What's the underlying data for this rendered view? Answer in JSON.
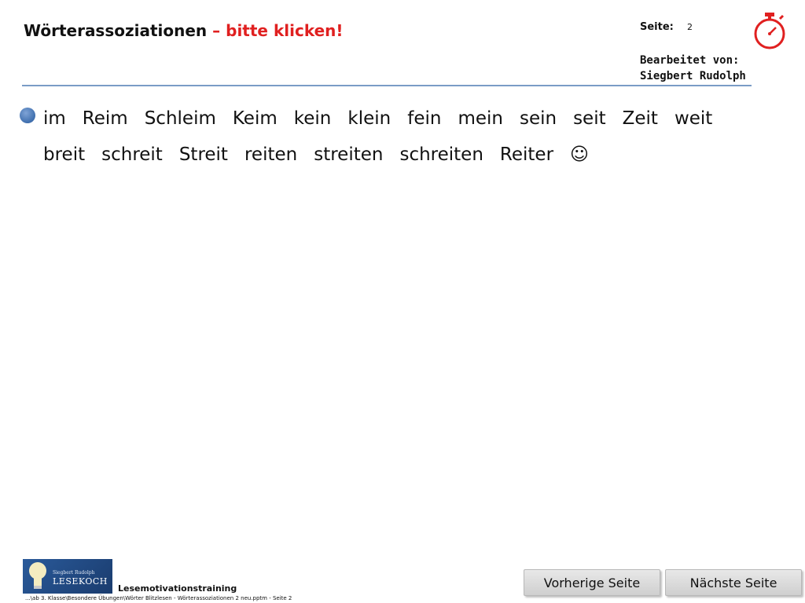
{
  "header": {
    "title_main": "Wörterassoziationen",
    "title_sep": " – ",
    "title_cta": "bitte klicken!",
    "page_label": "Seite:",
    "page_number": "2",
    "editor_label": "Bearbeitet von:",
    "editor_name": "Siegbert Rudolph"
  },
  "content": {
    "words": [
      "im",
      "Reim",
      "Schleim",
      "Keim",
      "kein",
      "klein",
      "fein",
      "mein",
      "sein",
      "seit",
      "Zeit",
      "weit",
      "breit",
      "schreit",
      "Streit",
      "reiten",
      "streiten",
      "schreiten",
      "Reiter",
      "☺"
    ]
  },
  "footer": {
    "logo_top": "Siegbert Rudolph",
    "logo_main": "LESEKOCH",
    "label": "Lesemotivationstraining",
    "path": "...\\ab 3. Klasse\\Besondere Übungen\\Wörter Blitzlesen - Wörterassoziationen 2 neu.pptm - Seite 2"
  },
  "nav": {
    "prev_label": "Vorherige Seite",
    "next_label": "Nächste Seite"
  },
  "colors": {
    "accent_red": "#e02020",
    "divider_blue": "#7a9cc6",
    "bullet_blue": "#3f6fae"
  },
  "icons": {
    "stopwatch": "stopwatch-icon",
    "bullet": "bullet-icon",
    "logo": "lightbulb-logo"
  }
}
